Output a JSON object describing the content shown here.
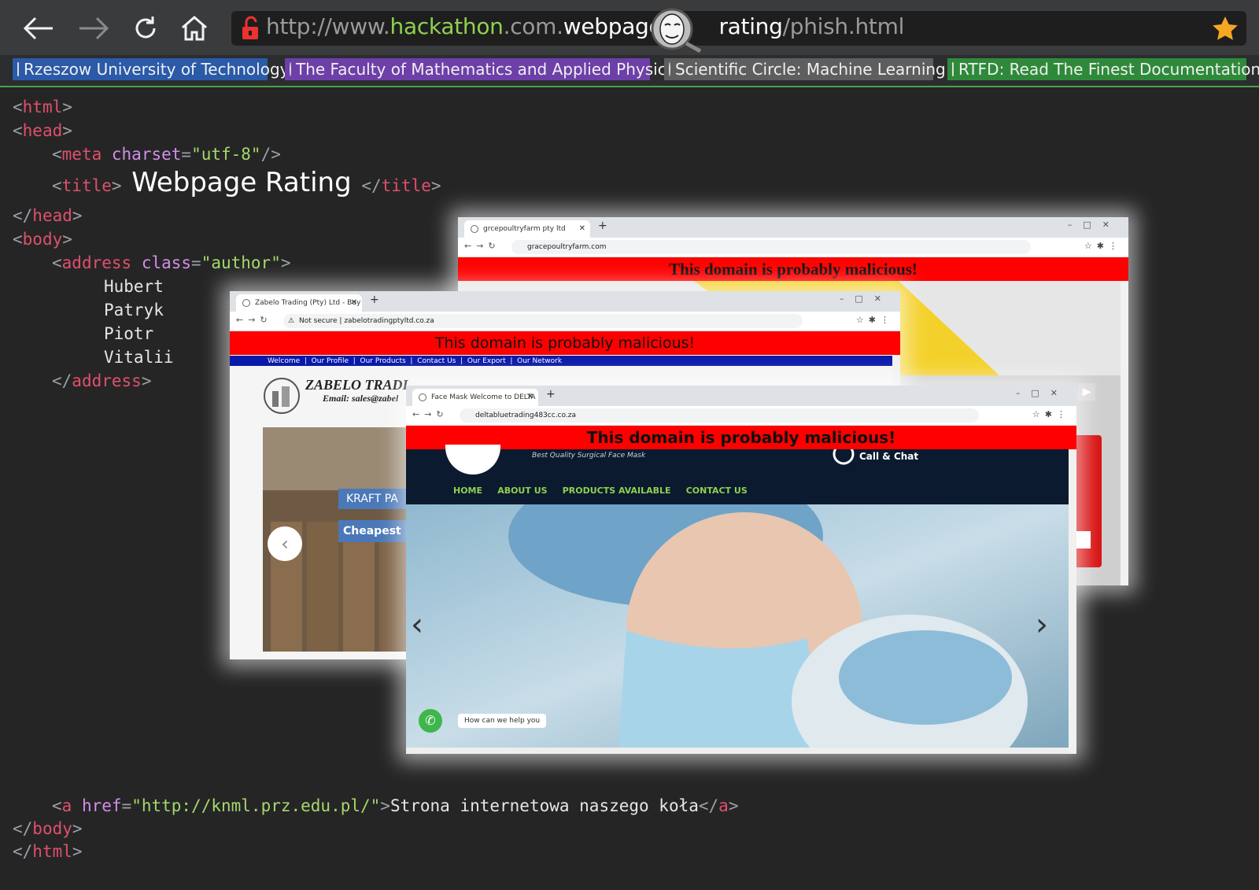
{
  "browser": {
    "url": {
      "scheme": "http://www.",
      "domain": "hackathon",
      "tld": ".com.",
      "site": "webpage",
      "path_a": "rating",
      "path_b": "/phish.html"
    },
    "bookmarks": [
      {
        "label": "Rzeszow University of Technology",
        "bg": "#2a5aa8"
      },
      {
        "label": "The Faculty of Mathematics and Applied Physics",
        "bg": "#6d3fa8"
      },
      {
        "label": "Scientific Circle: Machine Learning",
        "bg": "#5e5e5e"
      },
      {
        "label": "RTFD: Read The Finest Documentation",
        "bg": "#2e8a3a"
      }
    ]
  },
  "code": {
    "html_open": "html",
    "head_open": "head",
    "meta": "meta",
    "meta_attr": "charset",
    "meta_val": "\"utf-8\"",
    "title_tag": "title",
    "title_text": "Webpage Rating",
    "head_close": "head",
    "body_open": "body",
    "address": "address",
    "address_attr": "class",
    "address_val": "\"author\"",
    "authors": [
      "Hubert",
      "Patryk",
      "Piotr",
      "Vitalii"
    ],
    "a_tag": "a",
    "a_attr": "href",
    "a_val": "\"http://knml.prz.edu.pl/\"",
    "a_text": "Strona internetowa naszego koła",
    "body_close": "body",
    "html_close": "html"
  },
  "windows": [
    {
      "tab": "grcepoultryfarm pty ltd",
      "address": "gracepoultryfarm.com",
      "warning": "This domain is probably malicious!"
    },
    {
      "tab": "Zabelo Trading (Pty) Ltd - Buy C",
      "secure": "Not secure",
      "address": "zabelotradingptyltd.co.za",
      "warning": "This domain is probably malicious!",
      "nav": [
        "Welcome",
        "Our Profile",
        "Our Products",
        "Contact Us",
        "Our Export",
        "Our Network"
      ],
      "brand": "ZABELO TRADI",
      "email": "Email: sales@zabel",
      "banner1": "KRAFT PA",
      "banner2": "Cheapest K"
    },
    {
      "tab": "Face Mask Welcome to DELTA BL",
      "address": "deltabluetrading483cc.co.za",
      "warning": "This domain is probably malicious!",
      "tagline": "Best Quality Surgical Face Mask",
      "call": "Call & Chat",
      "menu": [
        "HOME",
        "ABOUT US",
        "PRODUCTS AVAILABLE",
        "CONTACT US"
      ],
      "chat": "How can we help you"
    }
  ],
  "colors": {
    "accent_green": "#8fd14f",
    "warning_red": "#ff0000",
    "tag_red": "#e0506a",
    "attr_purple": "#d28ee8",
    "value_green": "#a5d86a"
  }
}
